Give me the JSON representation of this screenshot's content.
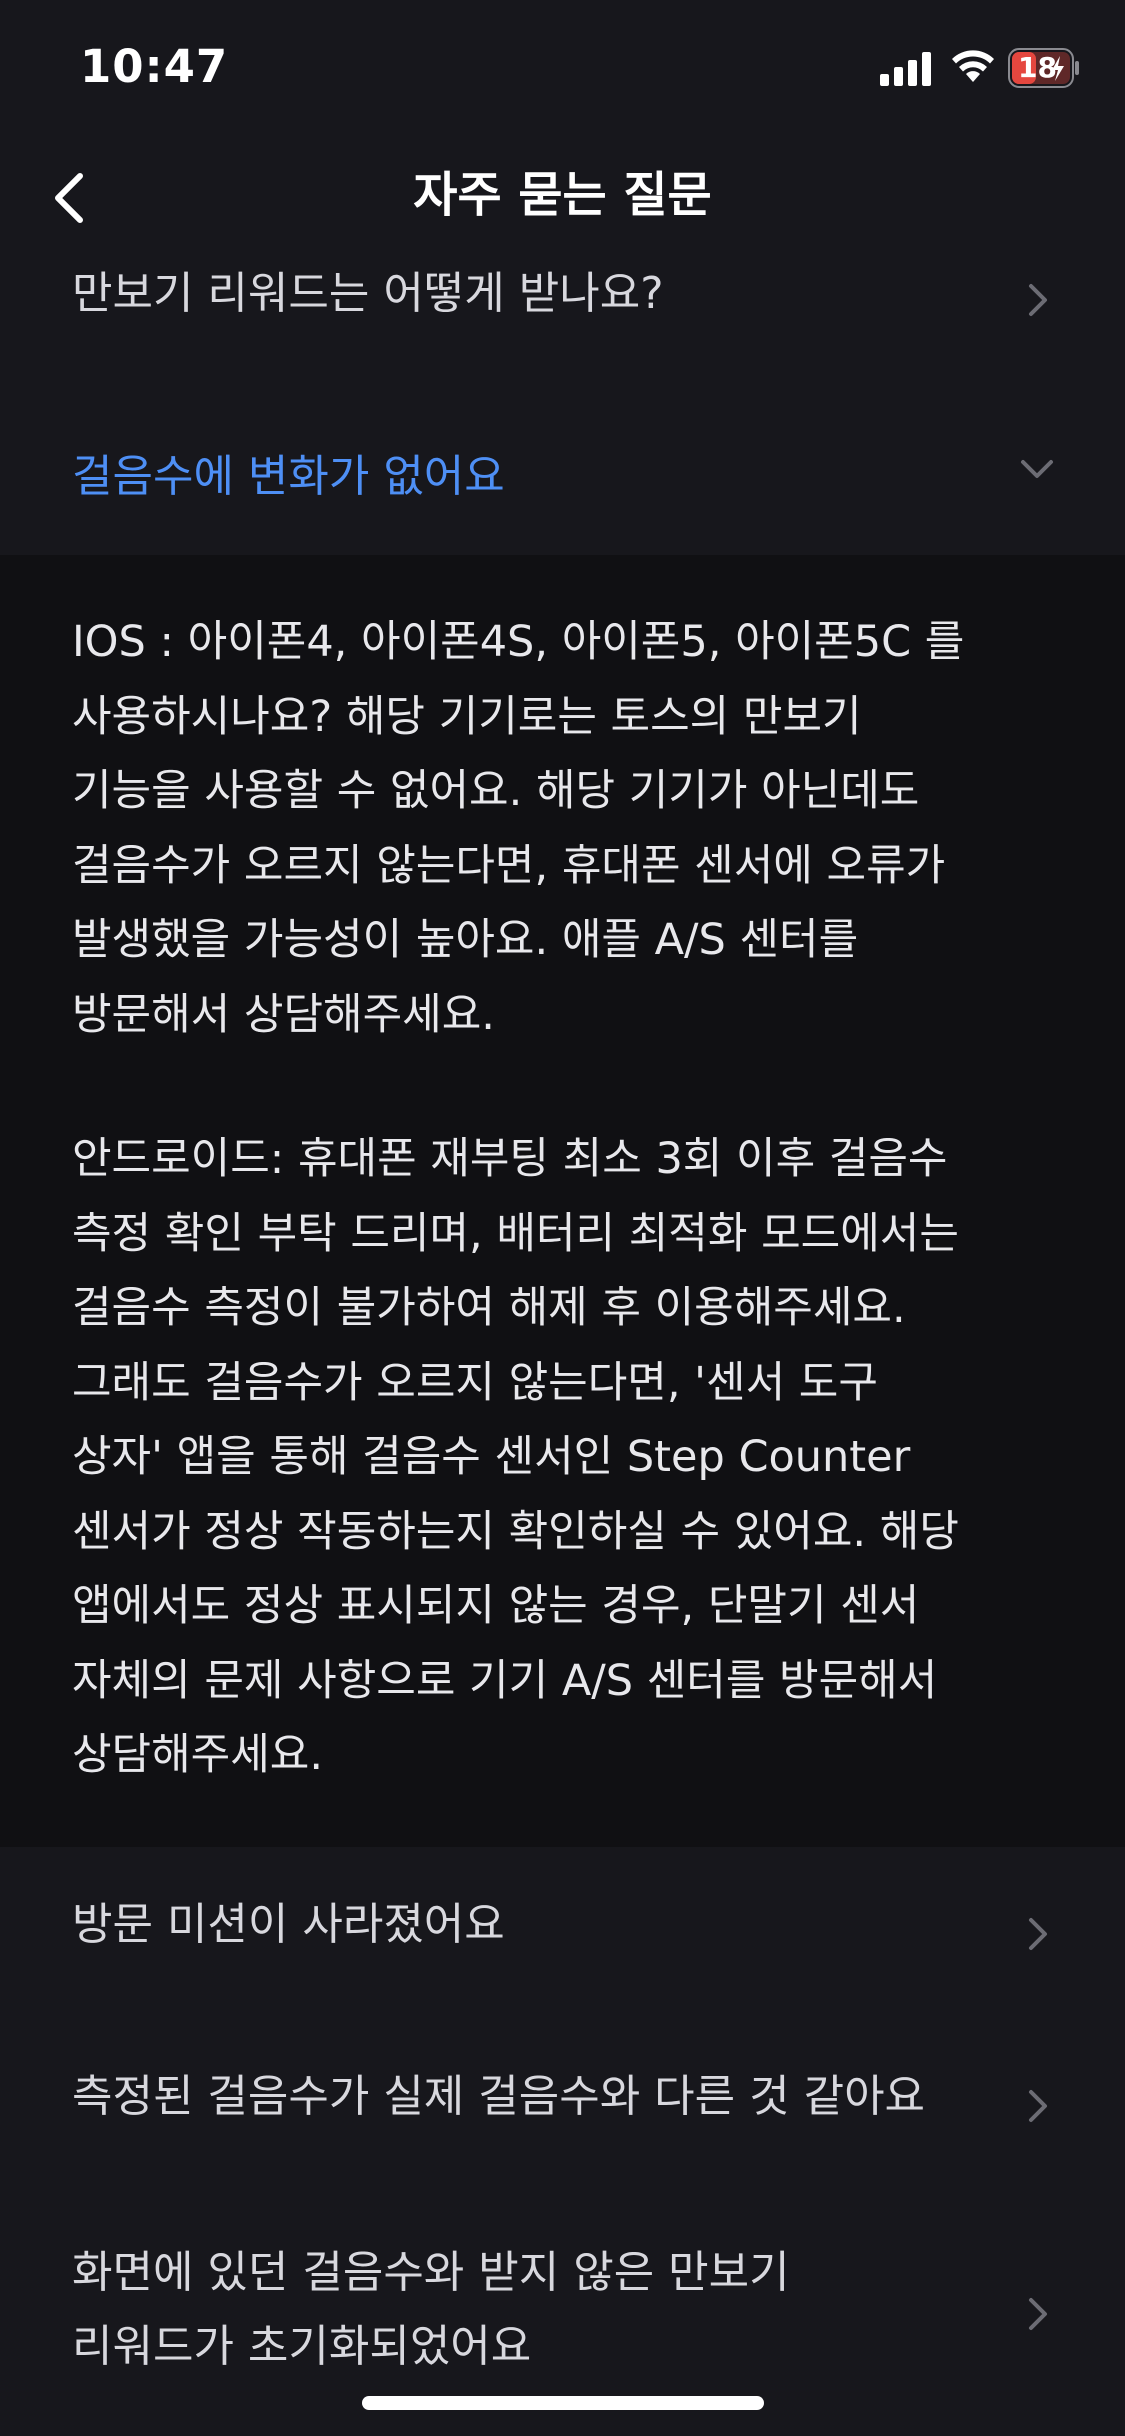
{
  "status_bar": {
    "time": "10:47",
    "battery": "18"
  },
  "nav": {
    "title": "자주 묻는 질문",
    "back_icon": "chevron-left-icon"
  },
  "faq": {
    "items_above": [
      {
        "label": "만보기 리워드는 어떻게 받나요?"
      }
    ],
    "expanded": {
      "label": "걸음수에 변화가 없어요",
      "answer_ios": "IOS : 아이폰4, 아이폰4S, 아이폰5, 아이폰5C 를\n사용하시나요? 해당 기기로는 토스의 만보기\n기능을 사용할 수 없어요. 해당 기기가 아닌데도\n걸음수가 오르지 않는다면, 휴대폰 센서에 오류가\n발생했을 가능성이 높아요. 애플 A/S 센터를\n방문해서 상담해주세요.",
      "answer_android": "안드로이드: 휴대폰 재부팅 최소 3회 이후 걸음수\n측정 확인 부탁 드리며, 배터리 최적화 모드에서는\n걸음수 측정이 불가하여 해제 후 이용해주세요.\n그래도 걸음수가 오르지 않는다면, '센서 도구\n상자' 앱을 통해 걸음수 센서인 Step Counter\n센서가 정상 작동하는지 확인하실 수 있어요. 해당\n앱에서도 정상 표시되지 않는 경우, 단말기 센서\n자체의 문제 사항으로 기기 A/S 센터를 방문해서\n상담해주세요."
    },
    "items_below": [
      {
        "label": "방문 미션이 사라졌어요"
      },
      {
        "label": "측정된 걸음수가 실제 걸음수와 다른 것 같아요"
      },
      {
        "label": "화면에 있던 걸음수와 받지 않은 만보기\n리워드가 초기화되었어요"
      }
    ]
  },
  "colors": {
    "background": "#17171c",
    "answer_background": "#101013",
    "accent": "#4e8ff5",
    "battery_low": "#e5483f"
  }
}
